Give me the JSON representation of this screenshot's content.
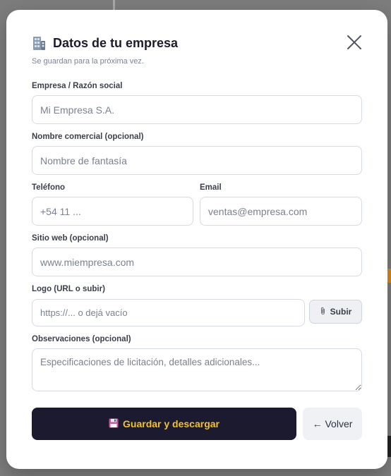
{
  "modal": {
    "title": "Datos de tu empresa",
    "subtitle": "Se guardan para la próxima vez."
  },
  "fields": {
    "company_name": {
      "label": "Empresa / Razón social",
      "placeholder": "Mi Empresa S.A."
    },
    "trade_name": {
      "label": "Nombre comercial (opcional)",
      "placeholder": "Nombre de fantasía"
    },
    "phone": {
      "label": "Teléfono",
      "placeholder": "+54 11 ..."
    },
    "email": {
      "label": "Email",
      "placeholder": "ventas@empresa.com"
    },
    "website": {
      "label": "Sitio web (opcional)",
      "placeholder": "www.miempresa.com"
    },
    "logo": {
      "label": "Logo (URL o subir)",
      "placeholder": "https://... o dejá vacío",
      "upload_label": "Subir"
    },
    "notes": {
      "label": "Observaciones (opcional)",
      "placeholder": "Especificaciones de licitación, detalles adicionales..."
    }
  },
  "actions": {
    "save_label": "Guardar y descargar",
    "back_label": "← Volver"
  },
  "icons": {
    "title": "building-icon",
    "close": "close-icon",
    "upload": "paperclip-icon",
    "save": "floppy-disk-icon"
  },
  "colors": {
    "primary_bg": "#1b1a2e",
    "primary_text": "#f2c12e",
    "modal_bg": "#ffffff"
  }
}
